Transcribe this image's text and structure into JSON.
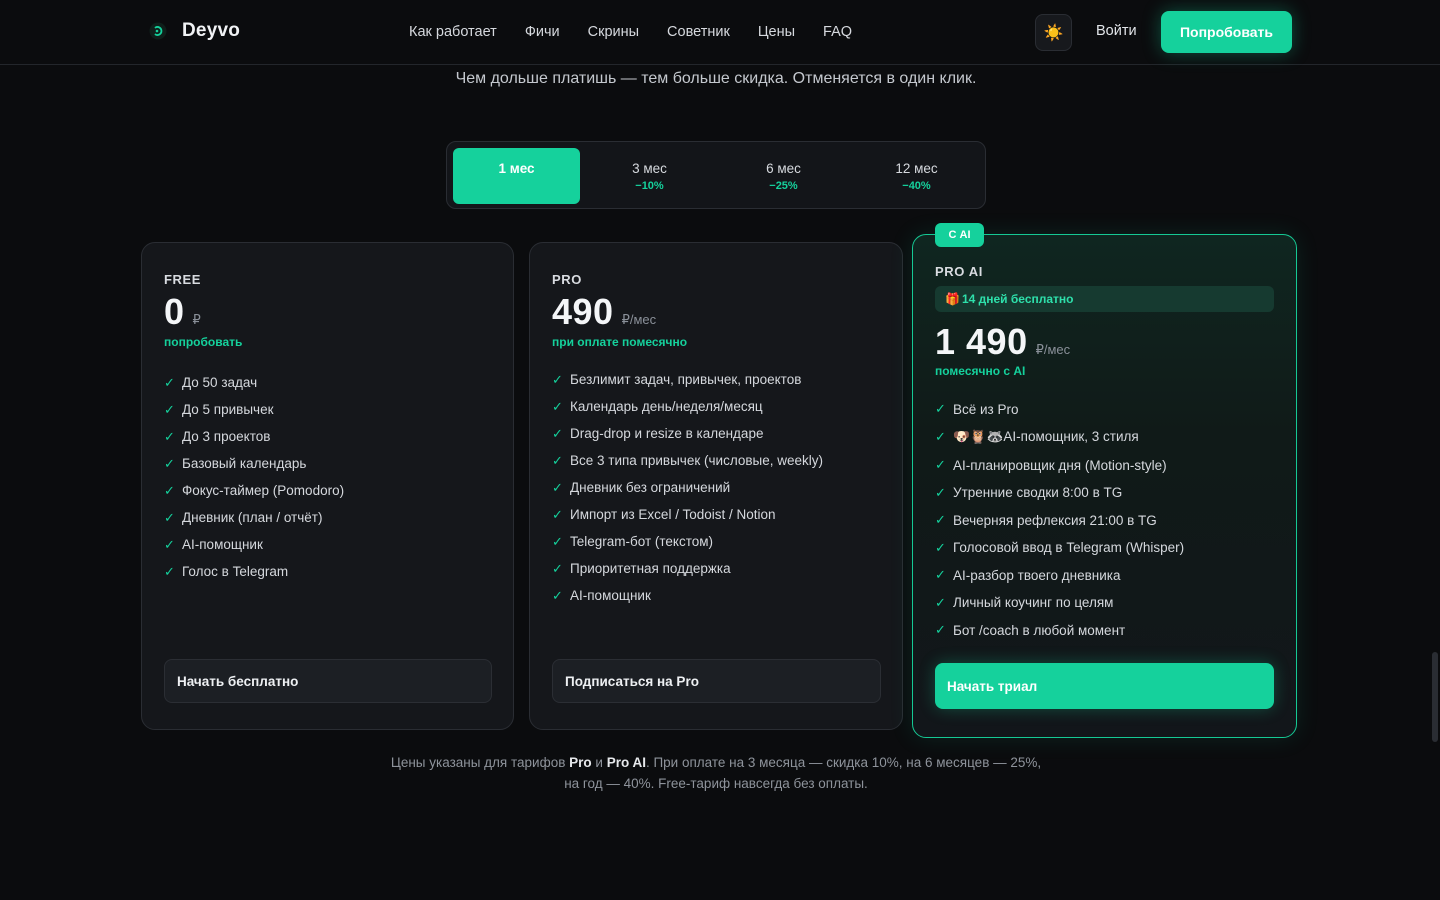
{
  "header": {
    "brand": "Deyvo",
    "nav": [
      "Как работает",
      "Фичи",
      "Скрины",
      "Советник",
      "Цены",
      "FAQ"
    ],
    "theme_icon": "☀️",
    "login": "Войти",
    "try": "Попробовать"
  },
  "subtitle": "Чем дольше платишь — тем больше скидка. Отменяется в один клик.",
  "periods": [
    {
      "label": "1 мес",
      "discount": "",
      "active": true
    },
    {
      "label": "3 мес",
      "discount": "−10%"
    },
    {
      "label": "6 мес",
      "discount": "−25%"
    },
    {
      "label": "12 мес",
      "discount": "−40%"
    }
  ],
  "plans": {
    "free": {
      "name": "FREE",
      "price": "0",
      "unit": "₽",
      "note": "попробовать",
      "features": [
        "До 50 задач",
        "До 5 привычек",
        "До 3 проектов",
        "Базовый календарь",
        "Фокус-таймер (Pomodoro)",
        "Дневник (план / отчёт)",
        "AI-помощник",
        "Голос в Telegram"
      ],
      "cta": "Начать бесплатно"
    },
    "pro": {
      "name": "PRO",
      "price": "490",
      "unit": "₽/мес",
      "note": "при оплате помесячно",
      "features": [
        "Безлимит задач, привычек, проектов",
        "Календарь день/неделя/месяц",
        "Drag-drop и resize в календаре",
        "Все 3 типа привычек (числовые, weekly)",
        "Дневник без ограничений",
        "Импорт из Excel / Todoist / Notion",
        "Telegram-бот (текстом)",
        "Приоритетная поддержка",
        "AI-помощник"
      ],
      "cta": "Подписаться на Pro"
    },
    "proai": {
      "badge": "С AI",
      "name": "PRO AI",
      "trial_icon": "🎁",
      "trial": "14 дней бесплатно",
      "price": "1 490",
      "unit": "₽/мес",
      "note": "помесячно с AI",
      "features": [
        "Всё из Pro",
        "🐶🦉🦝AI-помощник, 3 стиля",
        "AI-планировщик дня (Motion-style)",
        "Утренние сводки 8:00 в TG",
        "Вечерняя рефлексия 21:00 в TG",
        "Голосовой ввод в Telegram (Whisper)",
        "AI-разбор твоего дневника",
        "Личный коучинг по целям",
        "Бот /coach в любой момент"
      ],
      "cta": "Начать триал"
    }
  },
  "footnote": {
    "part1": "Цены указаны для тарифов ",
    "pro": "Pro",
    "and": " и ",
    "proai": "Pro AI",
    "part2": ". При оплате на 3 месяца — скидка 10%, на 6 месяцев — 25%,",
    "line2": "на год — 40%. Free-тариф навсегда без оплаты."
  },
  "colors": {
    "accent": "#15d19c",
    "background": "#0b0c0e",
    "card": "#15171b"
  }
}
